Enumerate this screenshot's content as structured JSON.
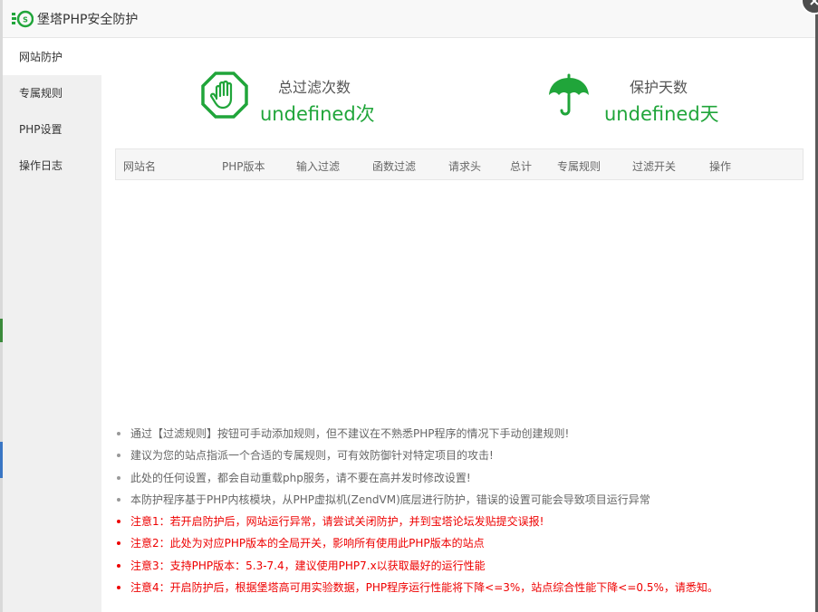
{
  "window": {
    "title": "堡塔PHP安全防护"
  },
  "sidebar": {
    "items": [
      {
        "label": "网站防护"
      },
      {
        "label": "专属规则"
      },
      {
        "label": "PHP设置"
      },
      {
        "label": "操作日志"
      }
    ]
  },
  "stats": {
    "total_filter": {
      "label": "总过滤次数",
      "value": "undefined次"
    },
    "protect_days": {
      "label": "保护天数",
      "value": "undefined天"
    }
  },
  "table": {
    "headers": [
      "网站名",
      "PHP版本",
      "输入过滤",
      "函数过滤",
      "请求头",
      "总计",
      "专属规则",
      "过滤开关",
      "操作"
    ],
    "rows": []
  },
  "notes": [
    {
      "text": "通过【过滤规则】按钮可手动添加规则，但不建议在不熟悉PHP程序的情况下手动创建规则!"
    },
    {
      "text": "建议为您的站点指派一个合适的专属规则，可有效防御针对特定项目的攻击!"
    },
    {
      "text": "此处的任何设置，都会自动重载php服务，请不要在高并发时修改设置!"
    },
    {
      "text": "本防护程序基于PHP内核模块，从PHP虚拟机(ZendVM)底层进行防护，错误的设置可能会导致项目运行异常"
    },
    {
      "text": "注意1：若开启防护后，网站运行异常，请尝试关闭防护，并到宝塔论坛发贴提交误报!"
    },
    {
      "text": "注意2：此处为对应PHP版本的全局开关，影响所有使用此PHP版本的站点"
    },
    {
      "text": "注意3：支持PHP版本：5.3-7.4，建议使用PHP7.x以获取最好的运行性能"
    },
    {
      "text": "注意4：开启防护后，根据堡塔高可用实验数据，PHP程序运行性能将下降<=3%，站点综合性能下降<=0.5%，请悉知。"
    }
  ],
  "icons": {
    "logo": "bt-logo-icon",
    "total_filter": "stop-hand-icon",
    "protect_days": "umbrella-icon",
    "close": "close-icon"
  },
  "colors": {
    "accent": "#20a53a",
    "warning": "#e00000"
  }
}
